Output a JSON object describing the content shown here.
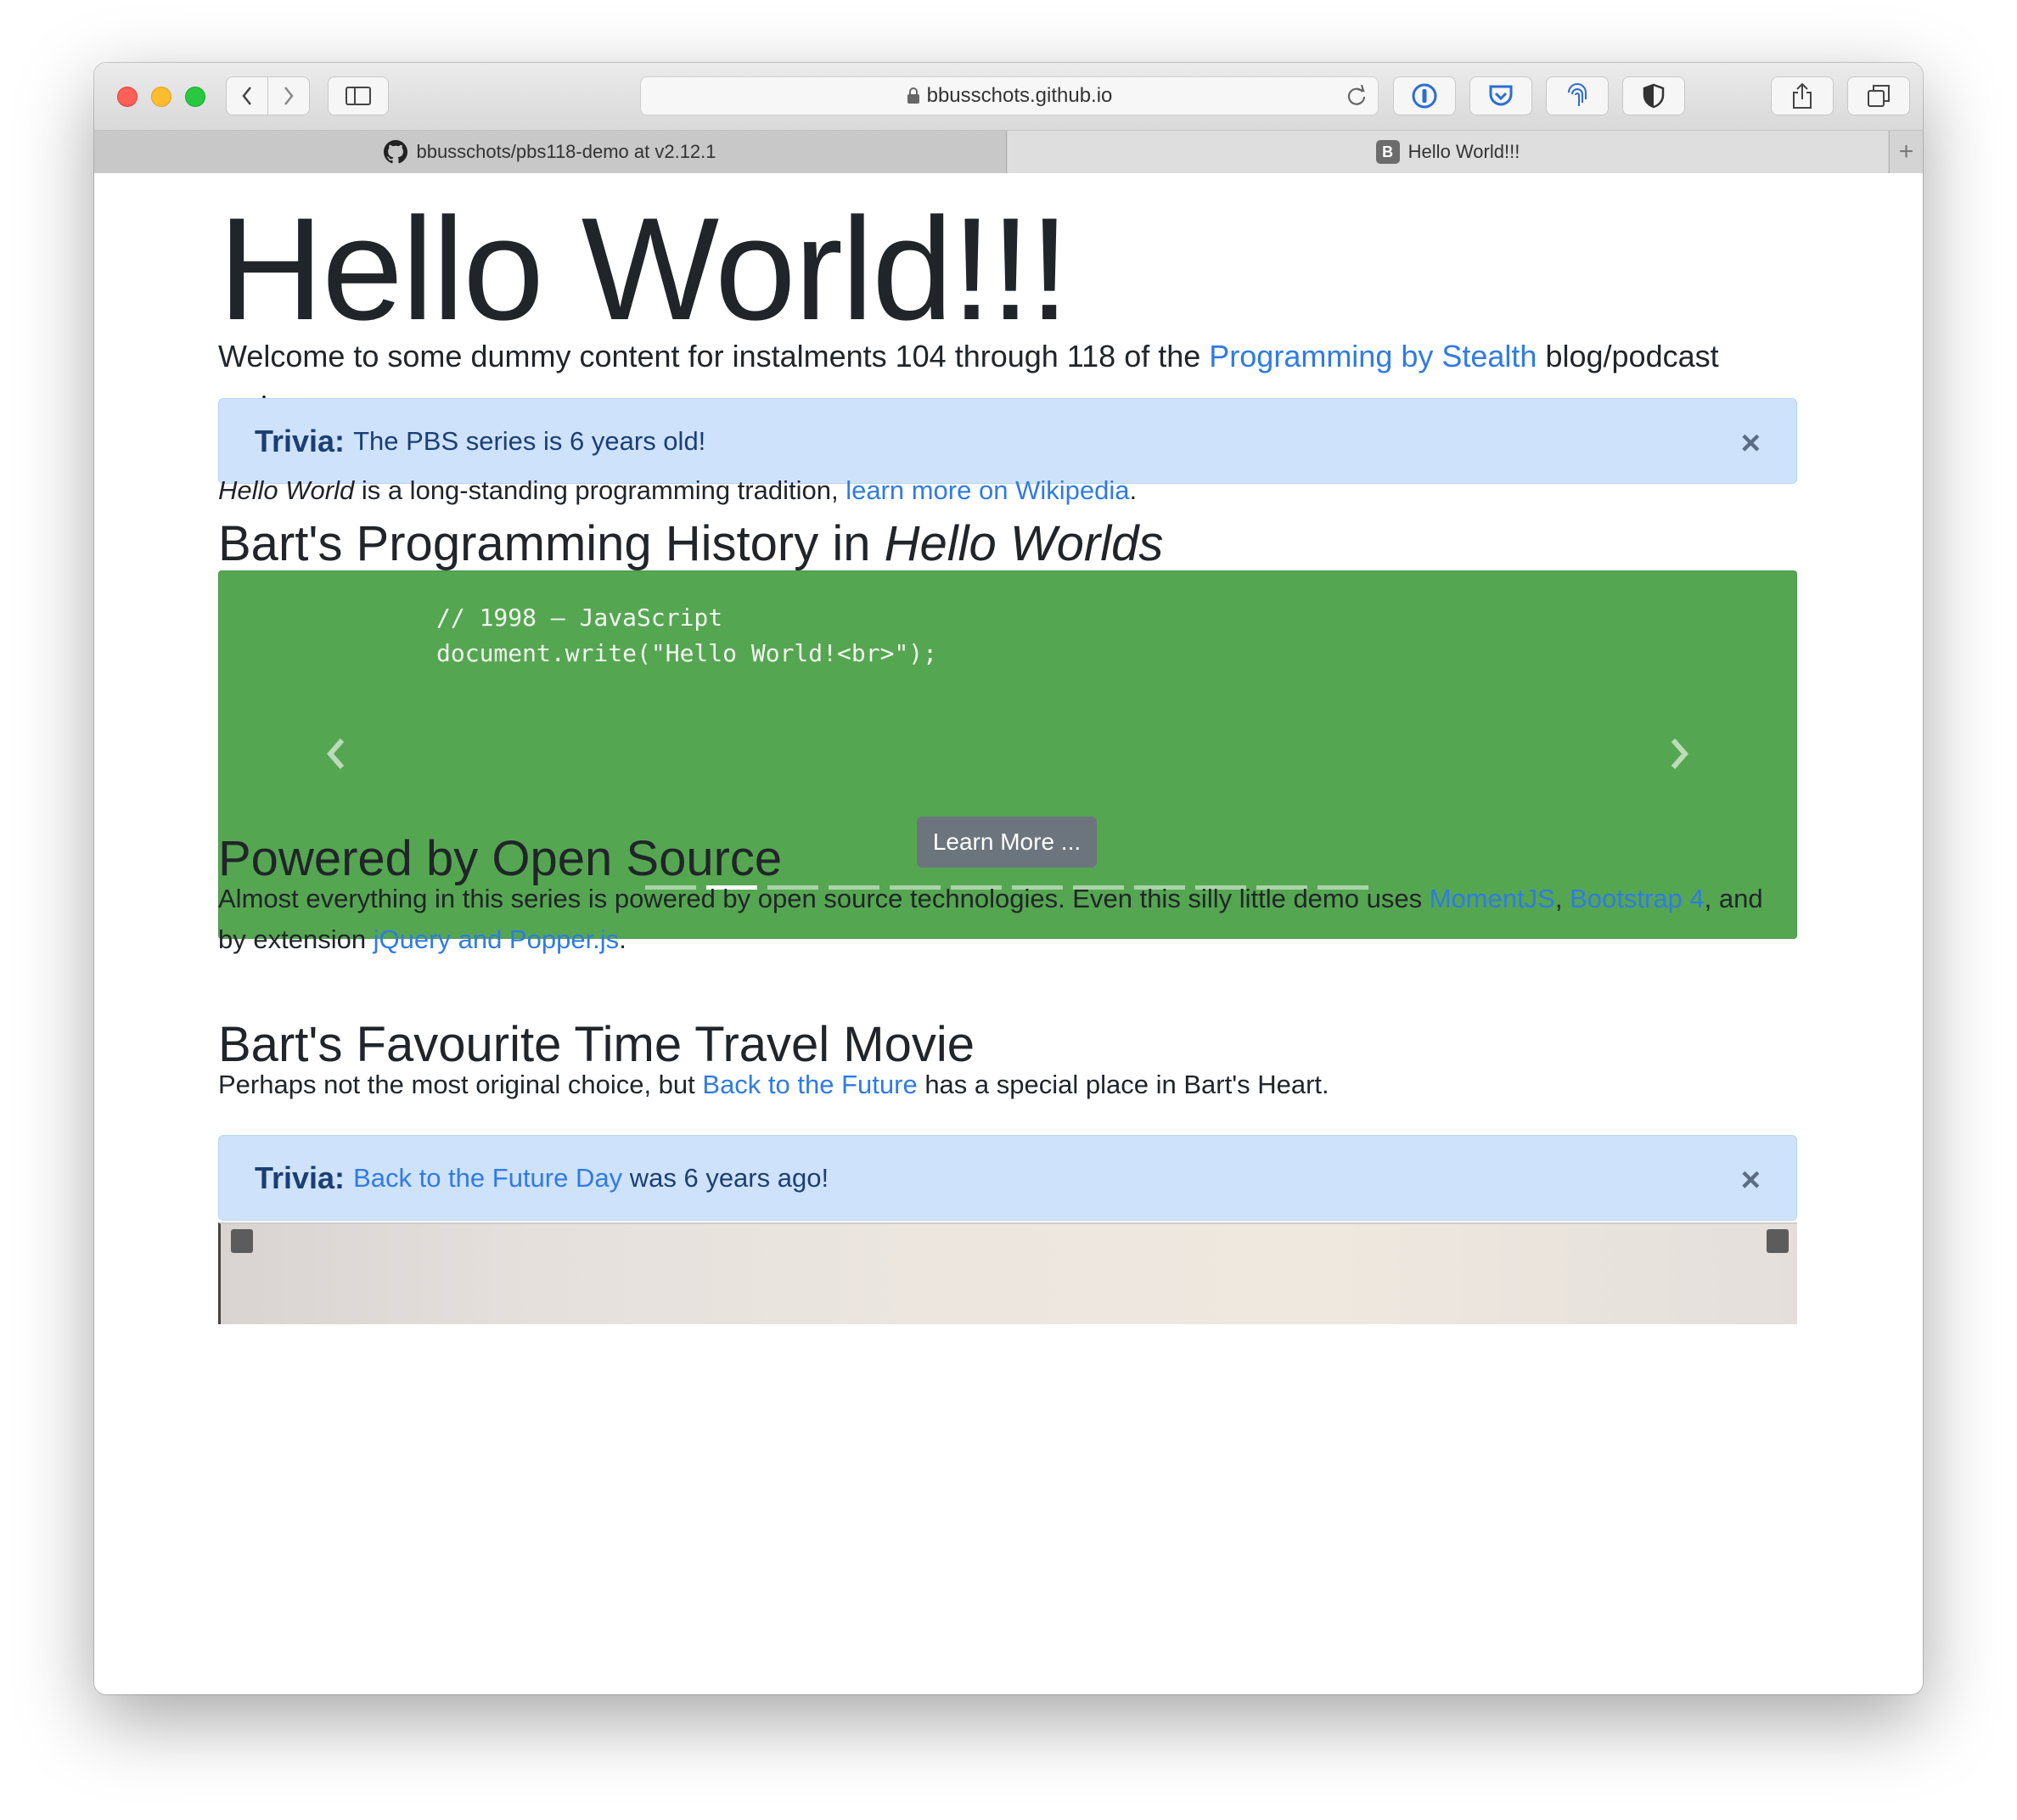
{
  "browser": {
    "url": "bbusschots.github.io",
    "tabs": [
      {
        "label": "bbusschots/pbs118-demo at v2.12.1",
        "icon": "github-icon"
      },
      {
        "label": "Hello World!!!",
        "icon": "bootstrap-icon",
        "icon_letter": "B"
      }
    ],
    "new_tab": "+"
  },
  "page": {
    "title": "Hello World!!!",
    "intro": {
      "text_before": "Welcome to some dummy content for instalments 104 through 118 of the ",
      "link": "Programming by Stealth",
      "text_after": " blog/podcast series."
    },
    "alert1": {
      "label": "Trivia:",
      "text": "The PBS series is 6 years old!",
      "close": "×"
    },
    "hello_para": {
      "em": "Hello World",
      "text": " is a long-standing programming tradition, ",
      "link": "learn more on Wikipedia",
      "end": "."
    },
    "history_heading": {
      "text": "Bart's Programming History in ",
      "em": "Hello Worlds"
    },
    "carousel": {
      "code_line1": "// 1998 — JavaScript",
      "code_line2": "document.write(\"Hello World!<br>\");",
      "button": "Learn More ...",
      "indicator_count": 12,
      "active_index": 1,
      "bg_color": "#55a651"
    },
    "open_source": {
      "heading": "Powered by Open Source",
      "text1": "Almost everything in this series is powered by open source technologies. Even this silly little demo uses ",
      "link1": "MomentJS",
      "sep1": ", ",
      "link2": "Bootstrap 4",
      "text2": ", and by extension ",
      "link3": "jQuery and Popper.js",
      "end": "."
    },
    "movie": {
      "heading": "Bart's Favourite Time Travel Movie",
      "text1": "Perhaps not the most original choice, but ",
      "link": "Back to the Future",
      "text2": " has a special place in Bart's Heart."
    },
    "alert2": {
      "label": "Trivia:",
      "link": "Back to the Future Day",
      "text": " was 6 years ago!",
      "close": "×"
    }
  },
  "colors": {
    "link": "#2f7be6",
    "alert_bg": "#cfe2fb",
    "alert_text": "#1b3f74",
    "carousel_bg": "#55a651"
  }
}
